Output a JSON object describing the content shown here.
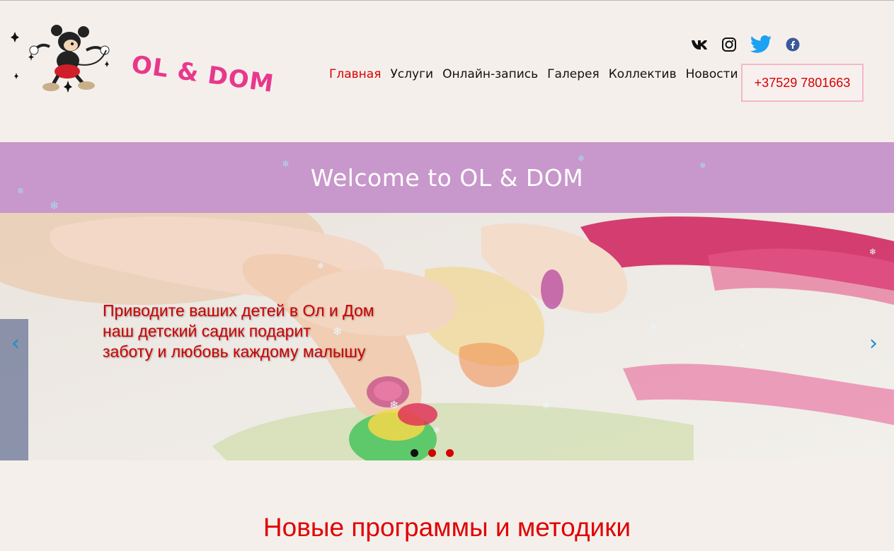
{
  "header": {
    "brand": "OL & DOM",
    "mascot_icon": "mickey-mouse-mascot",
    "social": [
      {
        "name": "vk-icon",
        "color": "#111111"
      },
      {
        "name": "instagram-icon",
        "color": "#111111"
      },
      {
        "name": "twitter-icon",
        "color": "#1da1f2"
      },
      {
        "name": "facebook-icon",
        "color": "#3b5998"
      }
    ],
    "nav": [
      {
        "label": "Главная",
        "active": true
      },
      {
        "label": "Услуги",
        "active": false
      },
      {
        "label": "Онлайн-запись",
        "active": false
      },
      {
        "label": "Галерея",
        "active": false
      },
      {
        "label": "Коллектив",
        "active": false
      },
      {
        "label": "Новости",
        "active": false
      }
    ],
    "phone": "+37529 7801663"
  },
  "welcome": {
    "text": "Welcome to OL & DOM"
  },
  "carousel": {
    "caption_lines": [
      "Приводите ваших детей в Ол и Дом",
      "наш детский садик подарит",
      "заботу и любовь каждому малышу"
    ],
    "prev_label": "‹",
    "next_label": "›",
    "slide_count": 3,
    "active_slide": 1
  },
  "section": {
    "title": "Новые программы и методики"
  },
  "colors": {
    "accent_red": "#d60000",
    "brand_pink": "#e8388c",
    "band_purple": "#c897cb",
    "page_bg": "#f5efec"
  }
}
